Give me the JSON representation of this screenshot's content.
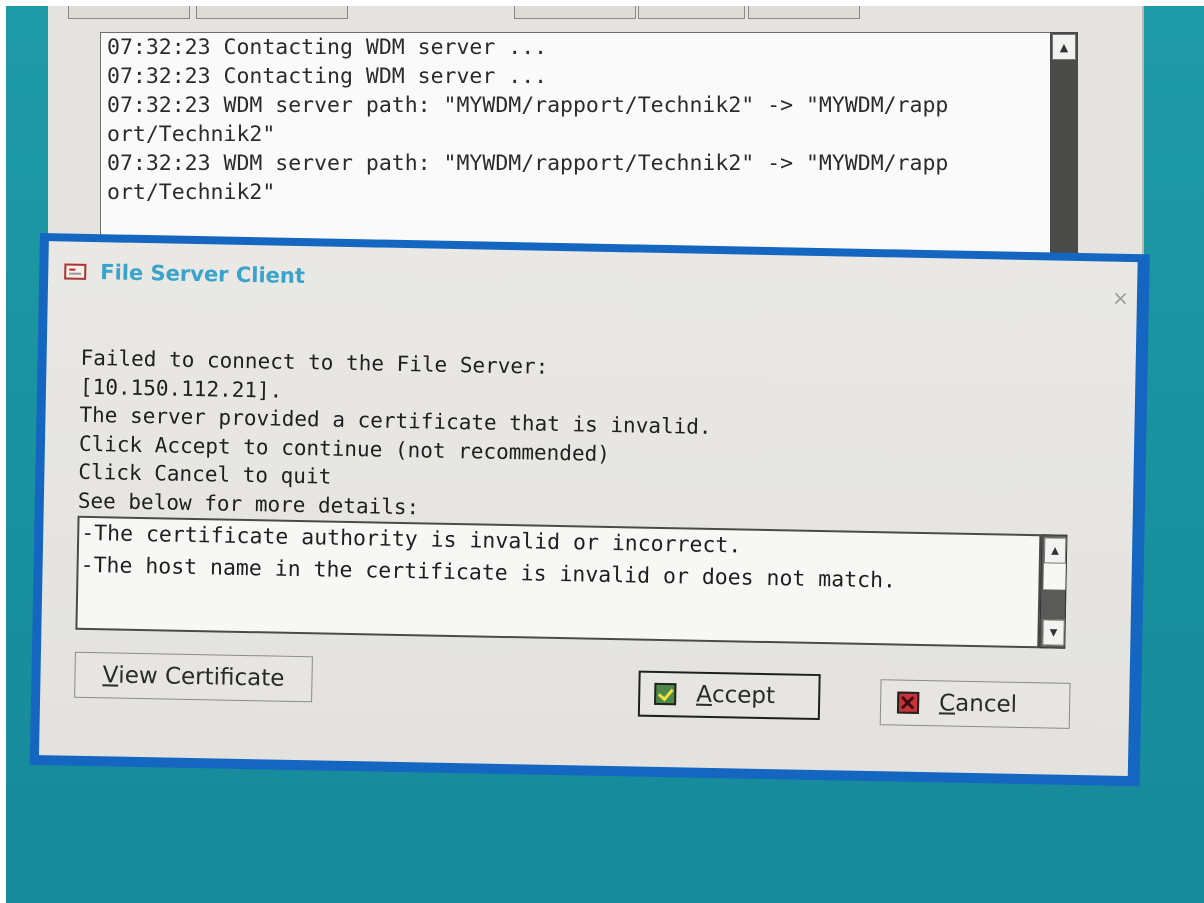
{
  "log_window": {
    "lines": [
      "07:32:23 Contacting WDM server ...",
      "07:32:23 Contacting WDM server ...",
      "07:32:23 WDM server path: \"MYWDM/rapport/Technik2\" -> \"MYWDM/rapp",
      "ort/Technik2\"",
      "07:32:23 WDM server path: \"MYWDM/rapport/Technik2\" -> \"MYWDM/rapp",
      "ort/Technik2\""
    ]
  },
  "dialog": {
    "title": "File Server Client",
    "close_glyph": "×",
    "message_lines": [
      "Failed to connect to the File Server:",
      "[10.150.112.21].",
      "The server provided a certificate that is invalid.",
      "Click Accept to continue (not recommended)",
      "Click Cancel to quit",
      "See below for more details:"
    ],
    "details_lines": [
      "-The certificate authority is invalid or incorrect.",
      "-The host name in the certificate is invalid or does not match."
    ],
    "buttons": {
      "view_certificate": {
        "mnemonic": "V",
        "rest": "iew Certificate"
      },
      "accept": {
        "mnemonic": "A",
        "rest": "ccept",
        "icon": "check-icon"
      },
      "cancel": {
        "mnemonic": "C",
        "rest": "ancel",
        "icon": "x-icon"
      }
    }
  },
  "colors": {
    "desktop": "#1a93a0",
    "dialog_border": "#1466c0",
    "title_text": "#3aa3cc",
    "dialog_bg": "#e6e5e1"
  }
}
